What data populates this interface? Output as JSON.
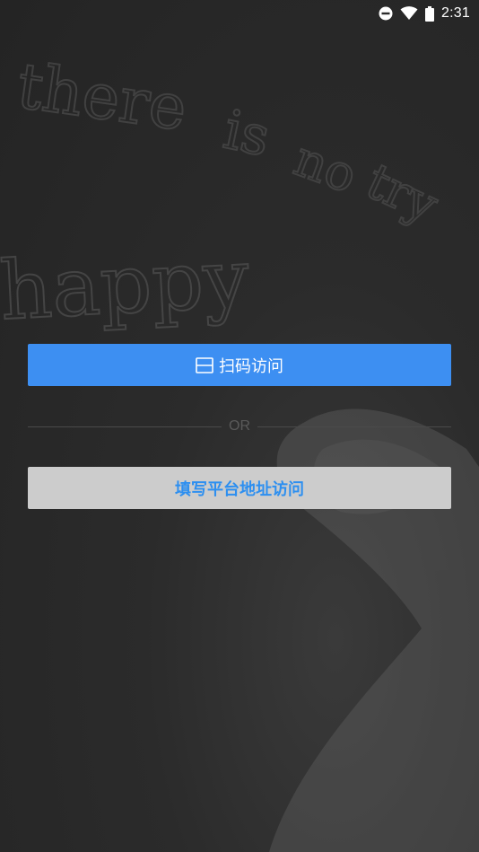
{
  "status_bar": {
    "time": "2:31",
    "icons": [
      "do-not-disturb-icon",
      "wifi-icon",
      "battery-icon"
    ]
  },
  "background": {
    "scribble_words": [
      "there",
      "is",
      "no",
      "try",
      "happy"
    ]
  },
  "actions": {
    "scan_label": "扫码访问",
    "scan_icon": "scan-icon",
    "divider_text": "OR",
    "address_label": "填写平台地址访问"
  },
  "colors": {
    "primary": "#3d8ff2",
    "secondary_bg": "#cccccc",
    "secondary_text": "#2d8ff0",
    "background": "#2b2b2b"
  }
}
